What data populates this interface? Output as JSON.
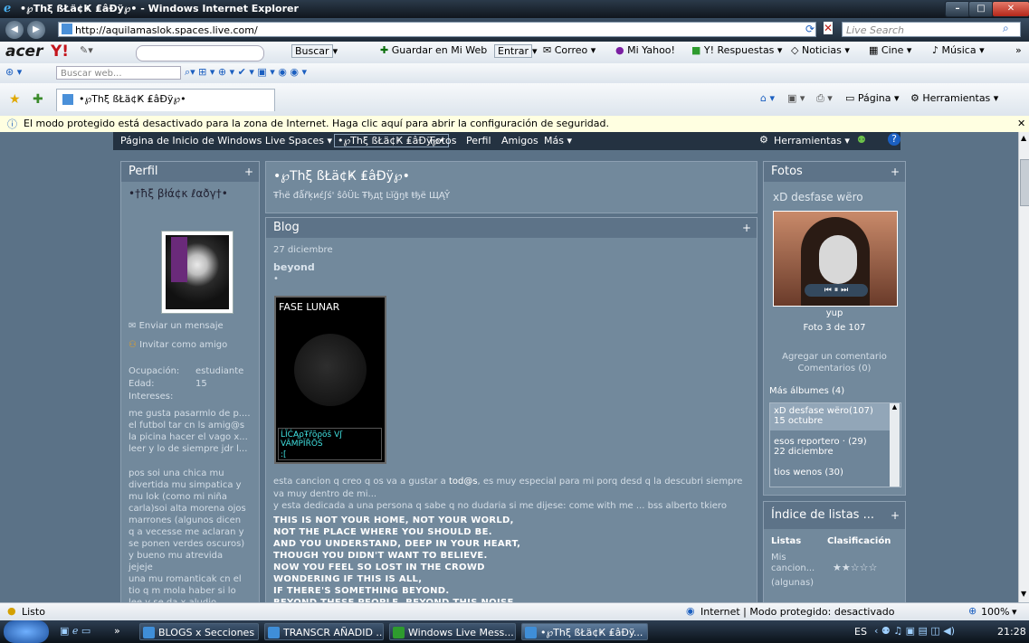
{
  "window": {
    "title": "•℘Thξ ßŁä¢Ҝ ₤âÐÿ℘• - Windows Internet Explorer"
  },
  "address": {
    "url": "http://aquilamaslok.spaces.live.com/",
    "search_placeholder": "Live Search"
  },
  "toolbar1": {
    "buscar": "Buscar",
    "guardar": "Guardar en Mi Web",
    "entrar": "Entrar",
    "correo": "Correo",
    "yahoo": "Mi Yahoo!",
    "respuestas": "Y! Respuestas",
    "noticias": "Noticias",
    "cine": "Cine",
    "musica": "Música"
  },
  "toolbar2": {
    "search_placeholder": "Buscar web..."
  },
  "tabs": {
    "active": "•℘Thξ ßŁä¢Ҝ ₤âÐÿ℘•",
    "pagina": "Página",
    "herramientas": "Herramientas"
  },
  "notice": {
    "text": "El modo protegido está desactivado para la zona de Internet. Haga clic aquí para abrir la configuración de seguridad."
  },
  "spaces_nav": {
    "home": "Página de Inicio de Windows Live Spaces ▾",
    "space": "•℘Thξ ßŁä¢Ҝ ₤âÐÿ℘•",
    "fotos": "Fotos",
    "perfil": "Perfil",
    "amigos": "Amigos",
    "mas": "Más ▾",
    "herramientas": "Herramientas ▾"
  },
  "perfil": {
    "heading": "Perfil",
    "name": "•†ħξ βłά¢κ ℓαðγ†•",
    "send_message": "Enviar un mensaje",
    "invite": "Invitar como amigo",
    "ocupacion_label": "Ocupación:",
    "ocupacion": "estudiante",
    "edad_label": "Edad:",
    "edad": "15",
    "intereses_label": "Intereses:",
    "intereses": [
      "me gusta pasarmlo de p....",
      "el futbol tar cn ls amig@s",
      "la picina hacer el vago x...",
      "leer y lo de siempre jdr l..."
    ],
    "about": [
      "pos soi una chica mu",
      "divertida mu simpatica y",
      "mu lok (como mi niña",
      "carla)soi alta morena ojos",
      "marrones (algunos dicen",
      "q a vecesse me aclaran y",
      "se ponen verdes oscuros)",
      "y bueno mu atrevida",
      "jejeje",
      "una mu romanticak cn el",
      "tio q m mola haber si lo",
      "lee y se da x aludio"
    ]
  },
  "space": {
    "title": "•℘Thξ ßŁä¢Ҝ ₤âÐÿ℘•",
    "subtitle": "Ŧĥё đǻřķиέʃś' ŝôÜĿ Ŧђдţ Ŀĭğŋŧ ŧђё ЩĄŶ"
  },
  "blog": {
    "heading": "Blog",
    "date": "27 diciembre",
    "post_title": "beyond",
    "bullet": "•",
    "moon_title": "FASE LUNAR",
    "moon_caption": "ĹĨĆĄρŦřõρōš Vʃ VÂMPĨŘŌŠ",
    "moon_caption2": ":[",
    "p1a": "esta cancion q creo q os va a gustar a ",
    "p1link": "tod@s",
    "p1b": ", es muy especial para mi porq desd q la descubri siempre",
    "p2": "va muy dentro de mi...",
    "p3": "y esta dedicada a una persona q sabe q no dudaria si me dijese: come with me ... bss alberto tkiero",
    "lyrics": [
      "THIS IS NOT YOUR HOME, NOT YOUR WORLD,",
      "NOT THE PLACE WHERE YOU SHOULD BE.",
      "AND YOU UNDERSTAND, DEEP IN YOUR HEART,",
      "THOUGH YOU DIDN'T WANT TO BELIEVE.",
      "NOW YOU FEEL SO LOST IN THE CROWD",
      "WONDERING IF THIS IS ALL,",
      "IF THERE'S SOMETHING BEYOND.",
      "BEYOND THESE PEOPLE, BEYOND THIS NOISE"
    ]
  },
  "fotos": {
    "heading": "Fotos",
    "album": "xD desfase wëro",
    "caption": "yup",
    "counter": "Foto 3 de 107",
    "add_comment": "Agregar un comentario",
    "comments": "Comentarios (0)",
    "more_albums": "Más álbumes (4)",
    "albums": [
      {
        "name": "xD desfase wëro(107)",
        "date": "15 octubre"
      },
      {
        "name": "esos reportero · (29)",
        "date": "22 diciembre"
      },
      {
        "name": "tios wenos      (30)",
        "date": ""
      }
    ]
  },
  "indice": {
    "heading": "Índice de listas ...",
    "col1": "Listas",
    "col2": "Clasificación",
    "item": "Mis cancion...",
    "rating_note": "(algunas)",
    "stars": "★★☆☆☆"
  },
  "status": {
    "left": "Listo",
    "zone": "Internet | Modo protegido: desactivado",
    "zoom": "100%"
  },
  "taskbar": {
    "items": [
      "BLOGS x Secciones -...",
      "TRANSCR AÑADID ...",
      "Windows Live Mess...",
      "•℘Thξ ßŁä¢Ҝ ₤âÐÿ..."
    ],
    "lang": "ES",
    "clock": "21:28"
  }
}
